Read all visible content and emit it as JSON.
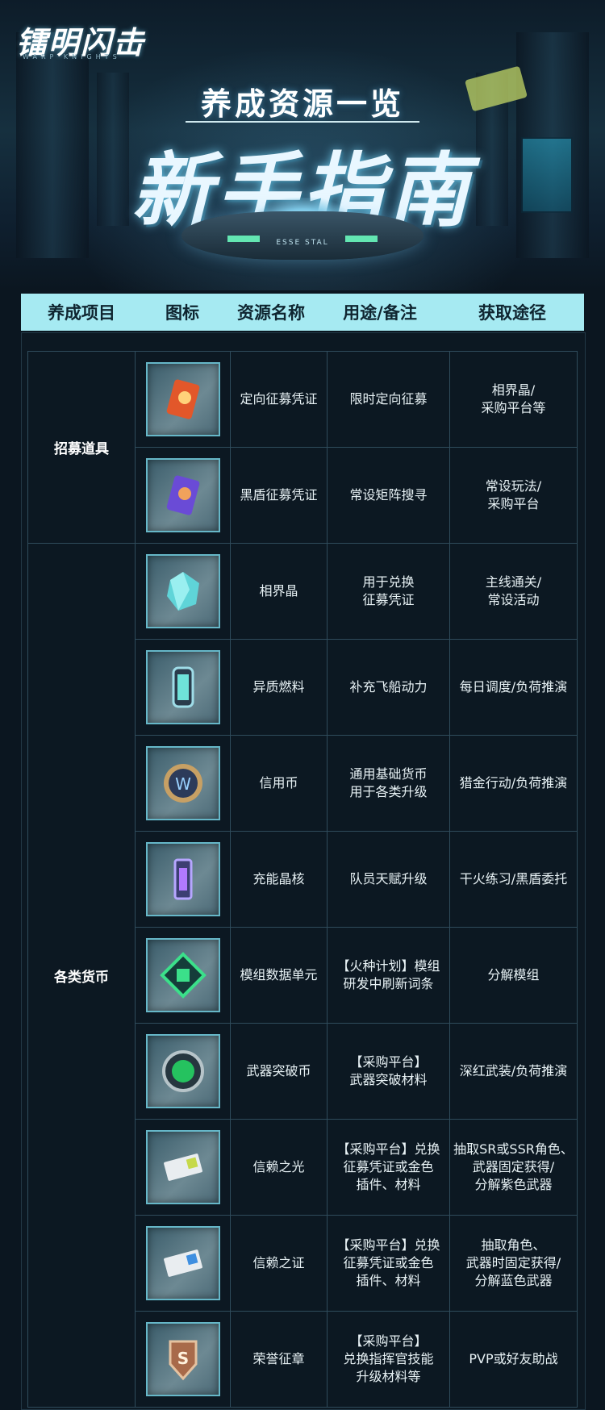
{
  "header": {
    "logo": "镭明闪击",
    "logo_sub": "WARP KNIGHTS",
    "subtitle": "养成资源一览",
    "title": "新手指南",
    "podium_label": "ESSE STAL"
  },
  "table": {
    "columns": [
      "养成项目",
      "图标",
      "资源名称",
      "用途/备注",
      "获取途径"
    ],
    "groups": [
      {
        "label": "招募道具"
      },
      {
        "label": "各类货币"
      }
    ],
    "rows": [
      {
        "icon": "recruit-ticket-orange-icon",
        "name": "定向征募凭证",
        "usage": "限时定向征募",
        "source": "相界晶/\n采购平台等"
      },
      {
        "icon": "recruit-ticket-purple-icon",
        "name": "黑盾征募凭证",
        "usage": "常设矩阵搜寻",
        "source": "常设玩法/\n采购平台"
      },
      {
        "icon": "cyan-crystal-icon",
        "name": "相界晶",
        "usage": "用于兑换\n征募凭证",
        "source": "主线通关/\n常设活动"
      },
      {
        "icon": "fuel-canister-icon",
        "name": "异质燃料",
        "usage": "补充飞船动力",
        "source": "每日调度/负荷推演"
      },
      {
        "icon": "credit-coin-icon",
        "name": "信用币",
        "usage": "通用基础货币\n用于各类升级",
        "source": "猎金行动/负荷推演"
      },
      {
        "icon": "energy-crystal-core-icon",
        "name": "充能晶核",
        "usage": "队员天赋升级",
        "source": "干火练习/黑盾委托"
      },
      {
        "icon": "module-data-unit-icon",
        "name": "模组数据单元",
        "usage": "【火种计划】模组\n研发中刷新词条",
        "source": "分解模组"
      },
      {
        "icon": "weapon-breakthrough-coin-icon",
        "name": "武器突破币",
        "usage": "【采购平台】\n武器突破材料",
        "source": "深红武装/负荷推演"
      },
      {
        "icon": "trust-light-ticket-icon",
        "name": "信赖之光",
        "usage": "【采购平台】兑换\n征募凭证或金色\n插件、材料",
        "source": "抽取SR或SSR角色、\n武器固定获得/\n分解紫色武器"
      },
      {
        "icon": "trust-proof-ticket-icon",
        "name": "信赖之证",
        "usage": "【采购平台】兑换\n征募凭证或金色\n插件、材料",
        "source": "抽取角色、\n武器时固定获得/\n分解蓝色武器"
      },
      {
        "icon": "honor-badge-icon",
        "name": "荣誉征章",
        "usage": "【采购平台】\n兑换指挥官技能\n升级材料等",
        "source": "PVP或好友助战"
      }
    ]
  },
  "colors": {
    "header_bg": "#a6eaf2",
    "table_bg": "#0c1822",
    "grid_line": "#2f4c5c",
    "icon_border": "#66b7c8"
  }
}
